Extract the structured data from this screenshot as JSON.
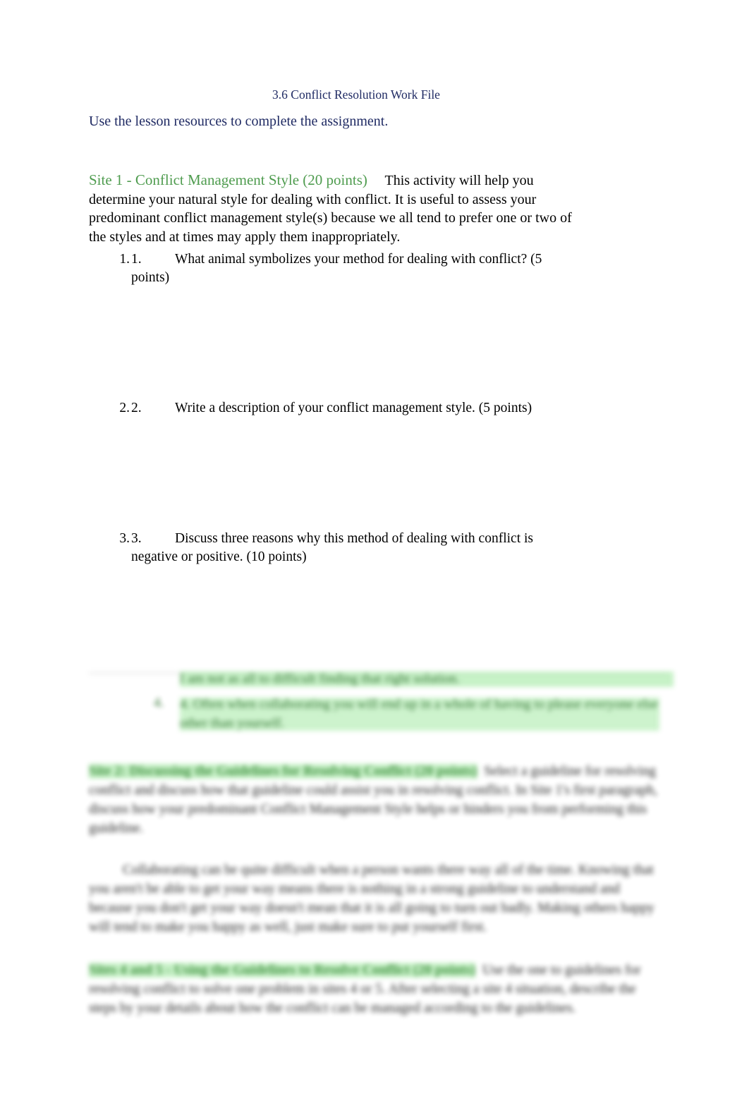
{
  "document": {
    "title": "3.6 Conflict Resolution Work File",
    "intro": "Use the lesson resources to complete the assignment.",
    "site1": {
      "heading": "Site 1 - Conflict Management Style (20 points)",
      "body": "This activity will help you determine your natural style for dealing with conflict. It is useful to assess your predominant conflict management style(s) because we all tend to prefer one or two of the styles and at times may apply them inappropriately."
    },
    "questions": [
      {
        "outer_number": "1.",
        "inner_number": "1.",
        "text": "What animal symbolizes your method for dealing with conflict? (5 points)"
      },
      {
        "outer_number": "2.",
        "inner_number": "2.",
        "text": "Write a description of your conflict management style. (5 points)"
      },
      {
        "outer_number": "3.",
        "inner_number": "3.",
        "text": "Discuss three reasons why this method of dealing with conflict is negative or positive. (10 points)"
      }
    ],
    "blurred": {
      "q4_text": "I am not as all to difficult finding that right solution.",
      "q5_number": "4.",
      "q5_text": "4. Often when collaborating you will end up in a whole of having to please everyone else other than yourself.",
      "site2_heading": "Site 2: Discussing the Guidelines for Resolving Conflict (20 points)",
      "site2_body": "Select a guideline for resolving conflict and discuss how that guideline could assist you in resolving conflict. In Site 1's first paragraph, discuss how your predominant Conflict Management Style helps or hinders you from performing this guideline.",
      "site2_para2": "Collaborating can be quite difficult when a person wants there way all of the time. Knowing that you aren't be able to get your way means there is nothing in a strong guideline to understand and because you don't get your way doesn't mean that it is all going to turn out badly. Making others happy will tend to make you happy as well, just make sure to put yourself first.",
      "site3_heading": "Sites 4 and 5 - Using the Guidelines to Resolve Conflict (20 points)",
      "site3_body": "Use the one to guidelines for resolving conflict to solve one problem in sites 4 or 5. After selecting a site 4 situation, describe the steps by your details about how the conflict can be managed according to the guidelines."
    }
  }
}
